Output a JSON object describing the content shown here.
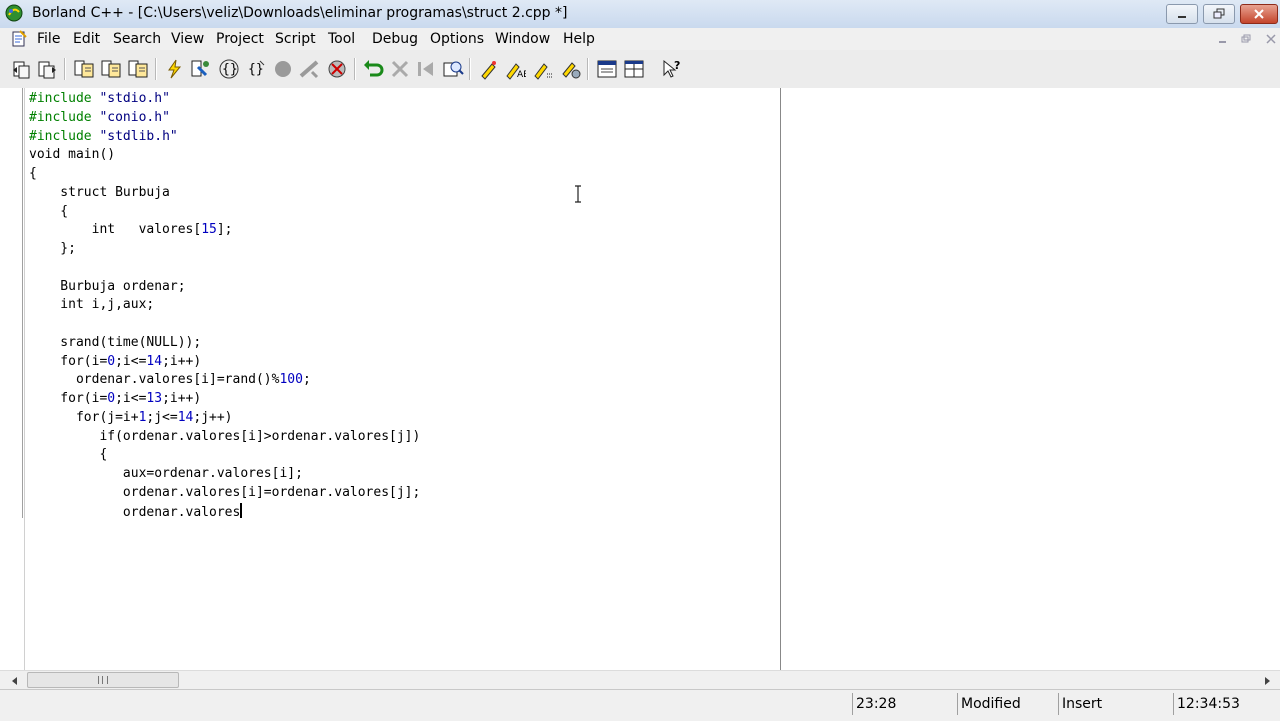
{
  "window": {
    "title": "Borland C++ - [C:\\Users\\veliz\\Downloads\\eliminar programas\\struct 2.cpp *]",
    "controls": [
      "minimize",
      "restore",
      "close"
    ]
  },
  "menu": {
    "items": [
      {
        "label": "File"
      },
      {
        "label": "Edit"
      },
      {
        "label": "Search"
      },
      {
        "label": "View"
      },
      {
        "label": "Project"
      },
      {
        "label": "Script"
      },
      {
        "label": "Tool"
      },
      {
        "label": "Debug"
      },
      {
        "label": "Options"
      },
      {
        "label": "Window"
      },
      {
        "label": "Help"
      }
    ]
  },
  "toolbar": {
    "icons": [
      "new-file-icon",
      "open-file-icon",
      "save-file-icon",
      "copy-icon",
      "paste-icon",
      "print-icon",
      "lightning-icon",
      "build-icon",
      "step-over-icon",
      "step-into-icon",
      "breakpoint-icon",
      "stop-icon",
      "run-icon",
      "undo-icon",
      "cut-icon",
      "back-icon",
      "browse-icon",
      "pencil-icon",
      "replace-icon",
      "highlight-icon",
      "settings-icon",
      "window-icon",
      "tile-icon",
      "help-pointer-icon"
    ]
  },
  "editor": {
    "lines": [
      "#include \"stdio.h\"",
      "#include \"conio.h\"",
      "#include \"stdlib.h\"",
      "void main()",
      "{",
      "    struct Burbuja",
      "    {",
      "        int   valores[15];",
      "    };",
      "",
      "    Burbuja ordenar;",
      "    int i,j,aux;",
      "",
      "    srand(time(NULL));",
      "    for(i=0;i<=14;i++)",
      "      ordenar.valores[i]=rand()%100;",
      "    for(i=0;i<=13;i++)",
      "      for(j=i+1;j<=14;j++)",
      "         if(ordenar.valores[i]>ordenar.valores[j])",
      "         {",
      "            aux=ordenar.valores[i];",
      "            ordenar.valores[i]=ordenar.valores[j];",
      "            ordenar.valores"
    ]
  },
  "status": {
    "position": "23:28",
    "modified": "Modified",
    "mode": "Insert",
    "time": "12:34:53"
  }
}
